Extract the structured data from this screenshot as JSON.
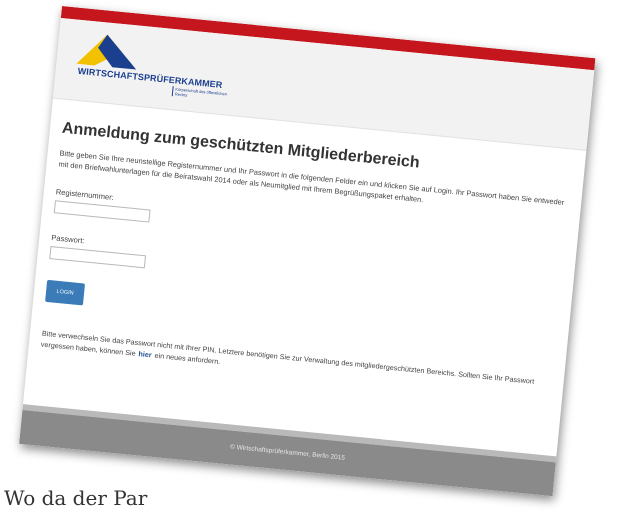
{
  "brand": {
    "name": "WIRTSCHAFTSPRÜFERKAMMER",
    "subtitle": "Körperschaft des öffentlichen Rechts",
    "colors": {
      "topbar": "#c4161c",
      "logo_yellow": "#f2c200",
      "logo_blue": "#1b3f8f",
      "button": "#3a7bb8",
      "footer": "#8a8a8a"
    }
  },
  "login": {
    "title": "Anmeldung zum geschützten Mitgliederbereich",
    "intro": "Bitte geben Sie Ihre neunstellige Registernummer und Ihr Passwort in die folgenden Felder ein und klicken Sie auf Login. Ihr Passwort haben Sie entweder mit den Briefwahlunterlagen für die Beiratswahl 2014 oder als Neumitglied mit Ihrem Begrüßungspaket erhalten.",
    "register_label": "Registernummer:",
    "register_value": "",
    "password_label": "Passwort:",
    "password_value": "",
    "button_label": "LOGIN",
    "note_before_link": "Bitte verwechseln Sie das Passwort nicht mit Ihrer PIN. Letztere benötigen Sie zur Verwaltung des mitgliedergeschützten Bereichs. Sollten Sie Ihr Passwort vergessen haben, können Sie",
    "link_text": "hier",
    "note_after_link": "ein neues anfordern."
  },
  "footer": {
    "copyright": "© Wirtschaftsprüferkammer, Berlin 2015"
  },
  "caption": {
    "text": "Wo da der Par"
  }
}
